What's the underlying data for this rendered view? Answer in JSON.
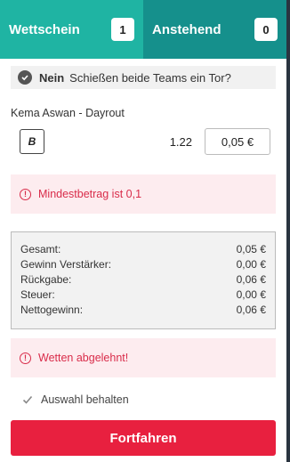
{
  "tabs": {
    "betslip_label": "Wettschein",
    "betslip_count": "1",
    "pending_label": "Anstehend",
    "pending_count": "0"
  },
  "selection": {
    "pick": "Nein",
    "market": "Schießen beide Teams ein Tor?"
  },
  "match": "Kema Aswan - Dayrout",
  "bet": {
    "badge": "B",
    "odds": "1.22",
    "stake": "0,05 €"
  },
  "alerts": {
    "min_amount": "Mindestbetrag ist 0,1",
    "rejected": "Wetten abgelehnt!"
  },
  "summary": [
    {
      "label": "Gesamt:",
      "value": "0,05 €"
    },
    {
      "label": "Gewinn Verstärker:",
      "value": "0,00 €"
    },
    {
      "label": "Rückgabe:",
      "value": "0,06 €"
    },
    {
      "label": "Steuer:",
      "value": "0,00 €"
    },
    {
      "label": "Nettogewinn:",
      "value": "0,06 €"
    }
  ],
  "keep_selection_label": "Auswahl behalten",
  "continue_label": "Fortfahren",
  "colors": {
    "tab_active": "#1fb4a3",
    "tab_inactive": "#15908c",
    "error_text": "#d92c4a",
    "error_bg": "#fdecef",
    "primary_button": "#e8203f"
  }
}
